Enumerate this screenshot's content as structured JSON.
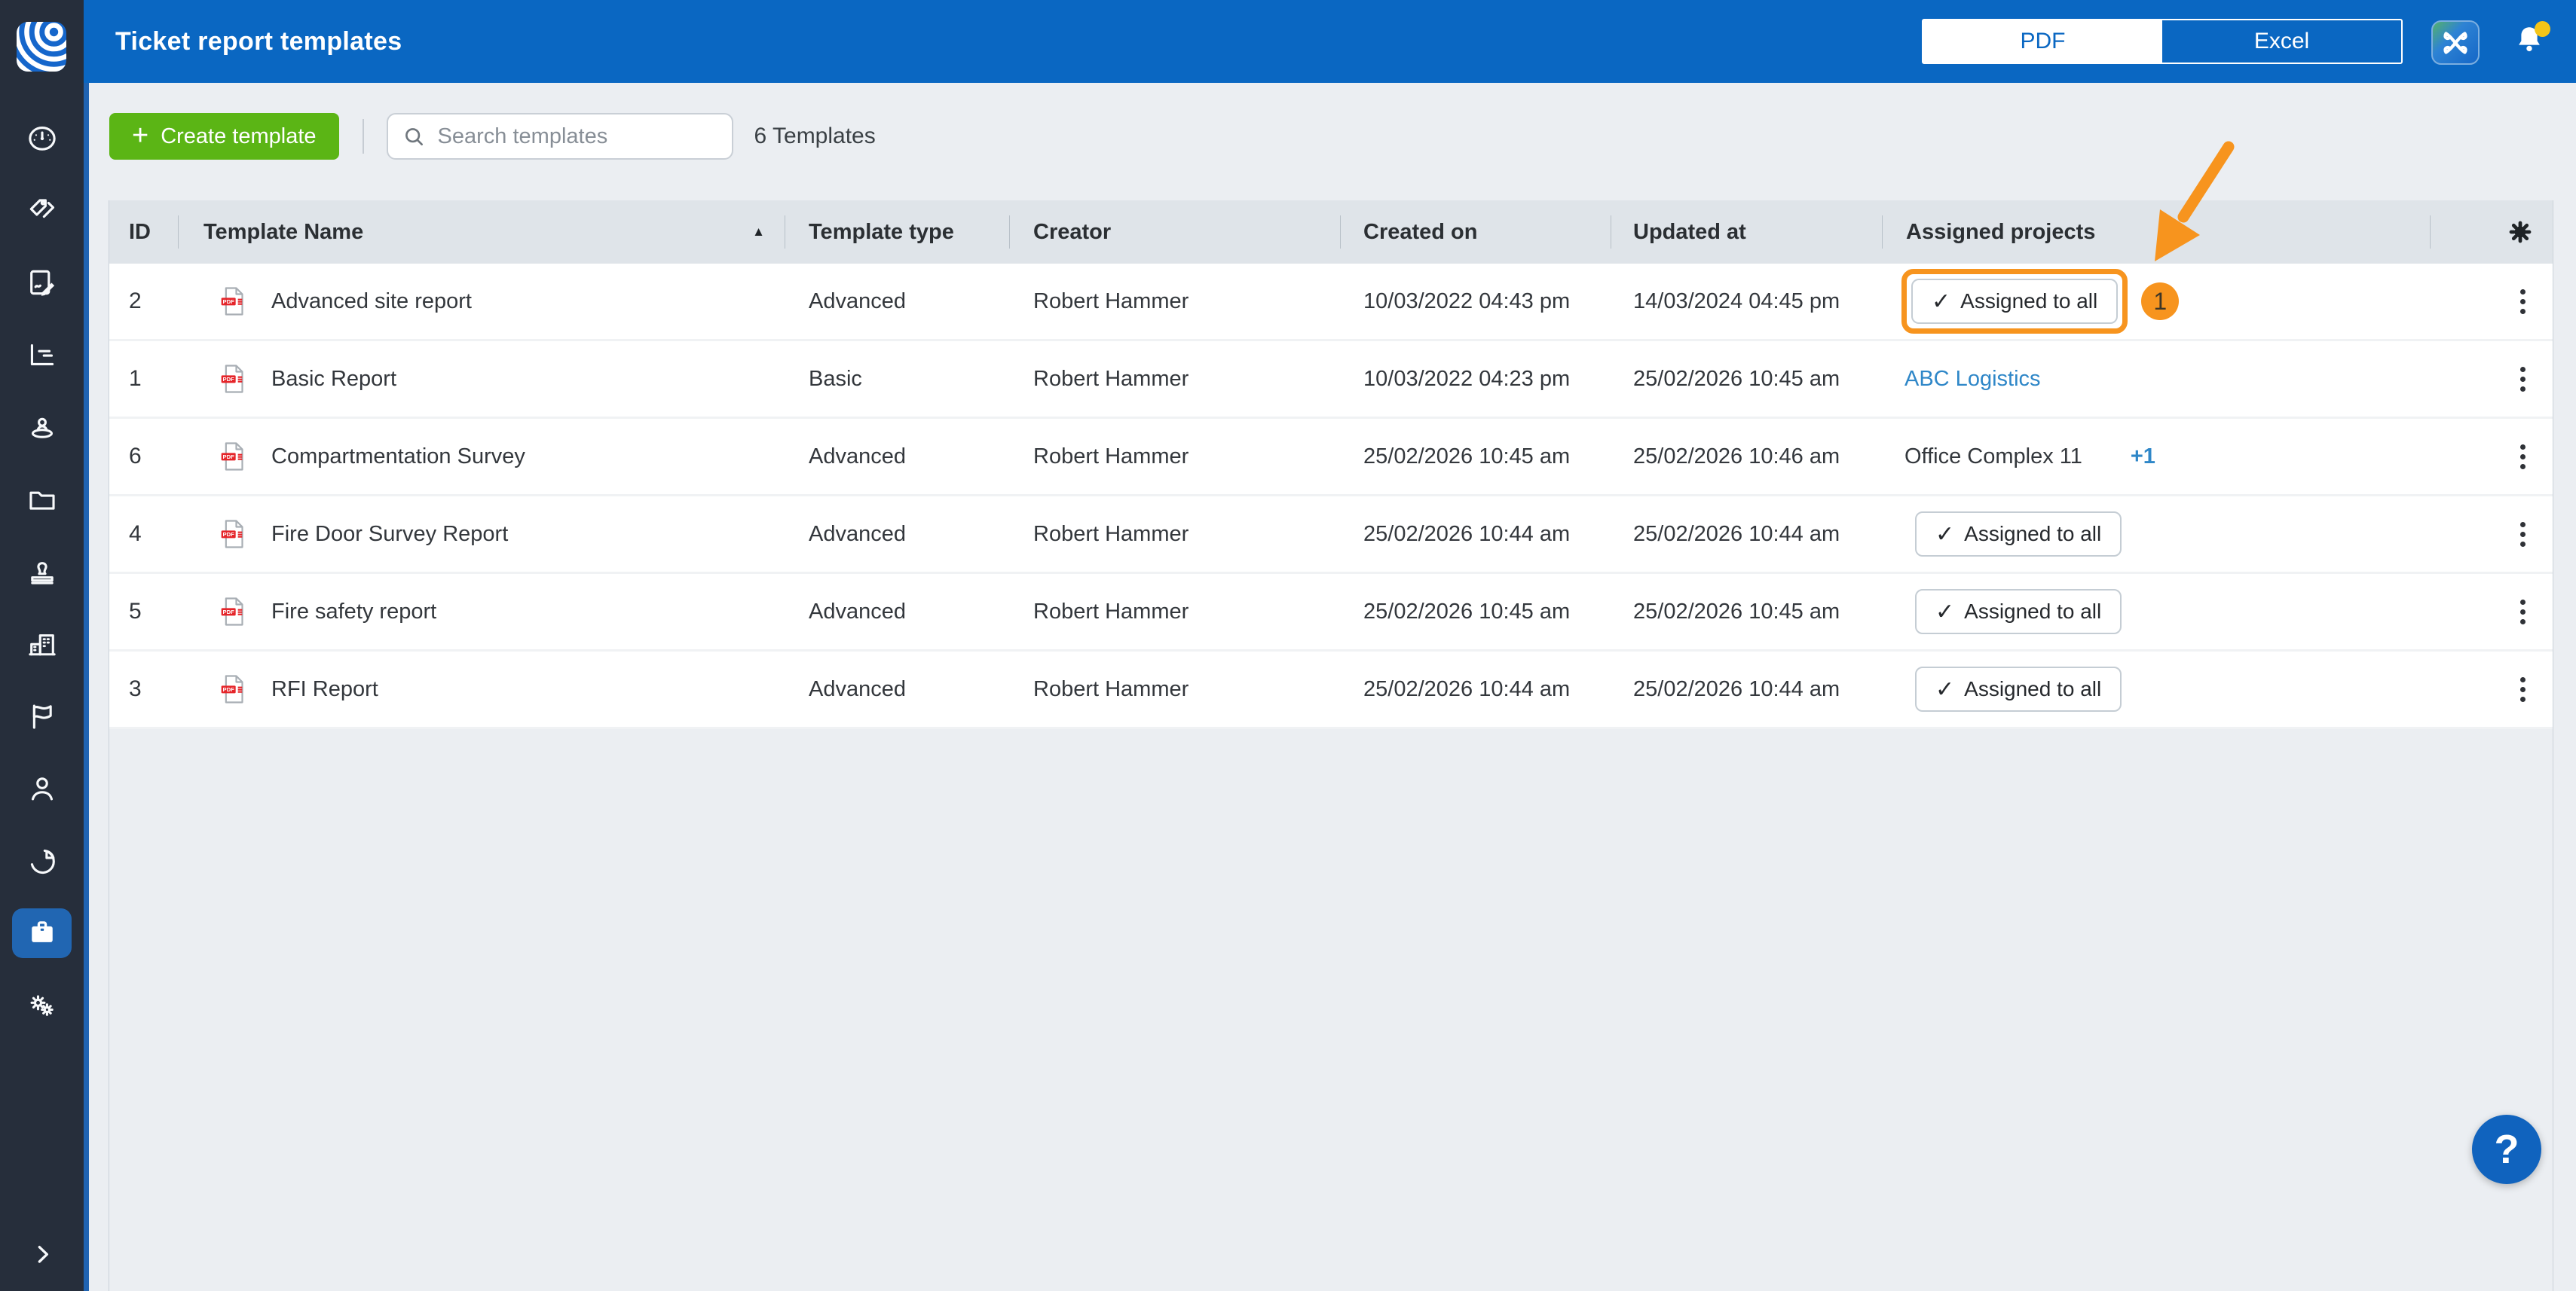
{
  "topbar": {
    "title": "Ticket report templates",
    "format_toggle": {
      "options": [
        "PDF",
        "Excel"
      ],
      "selected": "PDF"
    },
    "icons": [
      "app-switcher-icon",
      "notification-bell-icon"
    ],
    "notification_dot_color": "#F5C518"
  },
  "sidebar": {
    "logo_icon": "brand-logo",
    "items": [
      {
        "name": "dashboard",
        "icon": "dashboard-icon",
        "active": false
      },
      {
        "name": "tags",
        "icon": "tags-icon",
        "active": false
      },
      {
        "name": "sign-off",
        "icon": "signature-icon",
        "active": false
      },
      {
        "name": "reports",
        "icon": "chart-icon",
        "active": false
      },
      {
        "name": "site-staff",
        "icon": "person-pin-icon",
        "active": false
      },
      {
        "name": "documents",
        "icon": "folder-icon",
        "active": false
      },
      {
        "name": "stamps",
        "icon": "stamp-icon",
        "active": false
      },
      {
        "name": "companies",
        "icon": "buildings-icon",
        "active": false
      },
      {
        "name": "flags",
        "icon": "flag-icon",
        "active": false
      },
      {
        "name": "users",
        "icon": "user-icon",
        "active": false
      },
      {
        "name": "analytics",
        "icon": "pie-chart-icon",
        "active": false
      },
      {
        "name": "templates",
        "icon": "clipboard-icon",
        "active": true
      },
      {
        "name": "settings",
        "icon": "gears-icon",
        "active": false
      }
    ],
    "collapse_icon": "chevron-right-icon"
  },
  "toolbar": {
    "create_button_label": "Create template",
    "search_placeholder": "Search templates",
    "search_value": "",
    "templates_count": "6 Templates"
  },
  "table": {
    "columns": [
      "ID",
      "Template Name",
      "Template type",
      "Creator",
      "Created on",
      "Updated at",
      "Assigned projects"
    ],
    "sorted_column": "Template Name",
    "sort_direction": "asc",
    "row_icon": "pdf-file-icon",
    "assigned_all_label": "Assigned to all",
    "rows": [
      {
        "id": "2",
        "name": "Advanced site report",
        "type": "Advanced",
        "creator": "Robert Hammer",
        "created_on": "10/03/2022 04:43 pm",
        "updated_at": "14/03/2024 04:45 pm",
        "assigned_kind": "button",
        "assigned": "Assigned to all",
        "highlighted": true
      },
      {
        "id": "1",
        "name": "Basic Report",
        "type": "Basic",
        "creator": "Robert Hammer",
        "created_on": "10/03/2022 04:23 pm",
        "updated_at": "25/02/2026 10:45 am",
        "assigned_kind": "link",
        "assigned": "ABC Logistics"
      },
      {
        "id": "6",
        "name": "Compartmentation Survey",
        "type": "Advanced",
        "creator": "Robert Hammer",
        "created_on": "25/02/2026 10:45 am",
        "updated_at": "25/02/2026 10:46 am",
        "assigned_kind": "text-plus",
        "assigned": "Office Complex 11",
        "assigned_extra": "+1"
      },
      {
        "id": "4",
        "name": "Fire Door Survey Report",
        "type": "Advanced",
        "creator": "Robert Hammer",
        "created_on": "25/02/2026 10:44 am",
        "updated_at": "25/02/2026 10:44 am",
        "assigned_kind": "button",
        "assigned": "Assigned to all"
      },
      {
        "id": "5",
        "name": "Fire safety report",
        "type": "Advanced",
        "creator": "Robert Hammer",
        "created_on": "25/02/2026 10:45 am",
        "updated_at": "25/02/2026 10:45 am",
        "assigned_kind": "button",
        "assigned": "Assigned to all"
      },
      {
        "id": "3",
        "name": "RFI Report",
        "type": "Advanced",
        "creator": "Robert Hammer",
        "created_on": "25/02/2026 10:44 am",
        "updated_at": "25/02/2026 10:44 am",
        "assigned_kind": "button",
        "assigned": "Assigned to all"
      }
    ]
  },
  "annotation": {
    "badge": "1",
    "arrow_color": "#F7941E"
  },
  "help_button_label": "?",
  "colors": {
    "topbar": "#0A67C2",
    "sidebar": "#262E3B",
    "sidebar_active": "#2166B2",
    "create_button": "#5BB515",
    "link": "#2F87C8",
    "annotation_orange": "#F7941E",
    "table_header_bg": "#DFE4E9",
    "content_bg": "#EBEEF2"
  }
}
